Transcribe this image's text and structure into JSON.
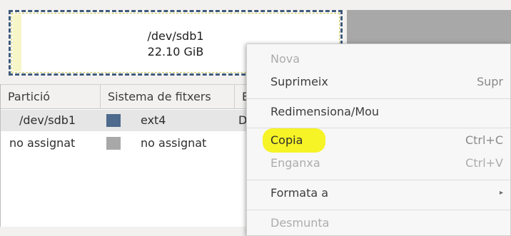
{
  "partition_map": {
    "selected": {
      "name": "/dev/sdb1",
      "size": "22.10 GiB"
    }
  },
  "table": {
    "columns": [
      "Partició",
      "Sistema de fitxers",
      "Et"
    ],
    "rows": [
      {
        "partition": "/dev/sdb1",
        "fs": "ext4",
        "fs_color": "#4e6a8c",
        "extra": "D"
      },
      {
        "partition": "no assignat",
        "fs": "no assignat",
        "fs_color": "#a8a8a8",
        "extra": ""
      }
    ]
  },
  "context_menu": {
    "items": [
      {
        "label": "Nova",
        "accel": "",
        "enabled": false
      },
      {
        "label": "Suprimeix",
        "accel": "Supr",
        "enabled": true
      },
      {
        "label": "Redimensiona/Mou",
        "accel": "",
        "enabled": true
      },
      {
        "label": "Copia",
        "accel": "Ctrl+C",
        "enabled": true,
        "highlighted": true
      },
      {
        "label": "Enganxa",
        "accel": "Ctrl+V",
        "enabled": false
      },
      {
        "label": "Formata a",
        "accel": "",
        "enabled": true,
        "submenu_icon": "chevron-right-icon"
      },
      {
        "label": "Desmunta",
        "accel": "",
        "enabled": false
      }
    ]
  },
  "colors": {
    "highlight": "#f6f21a",
    "ext4": "#4e6a8c",
    "unallocated": "#a8a8a8"
  }
}
